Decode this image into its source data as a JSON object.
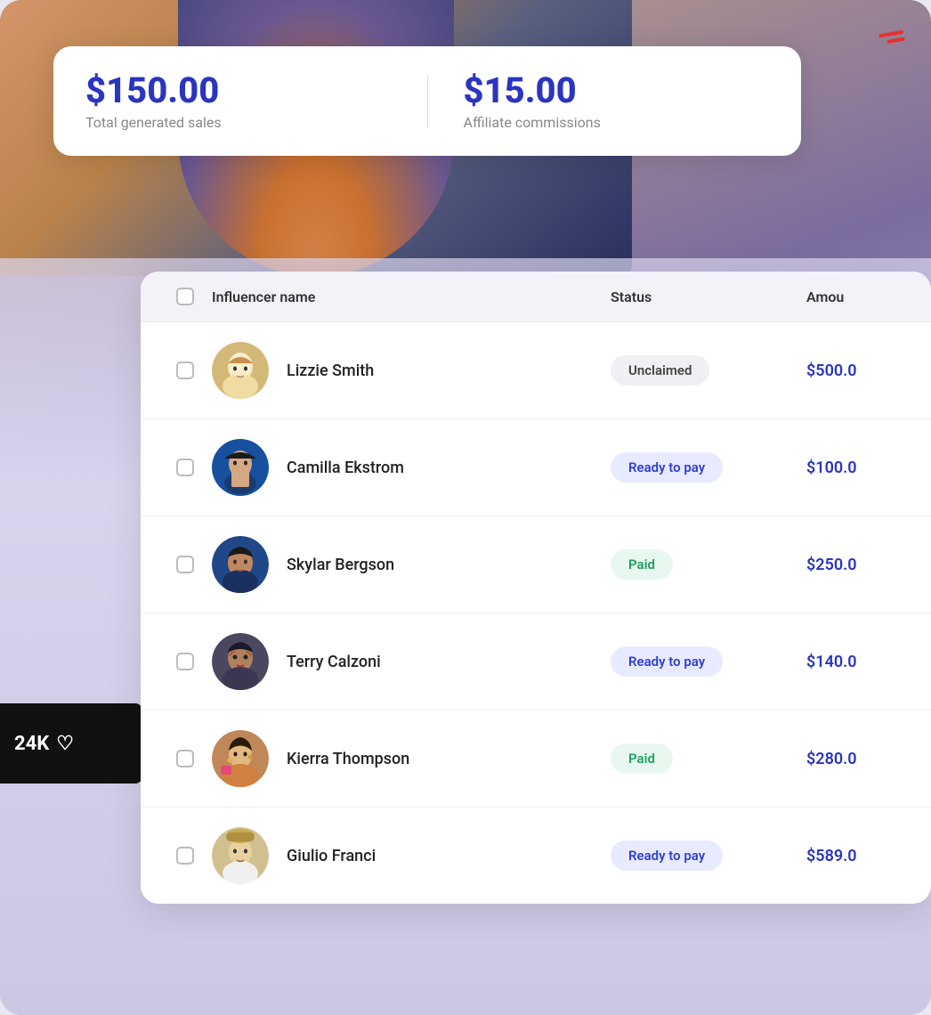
{
  "stats": {
    "total_sales_value": "$150.00",
    "total_sales_label": "Total generated sales",
    "commissions_value": "$15.00",
    "commissions_label": "Affiliate commissions"
  },
  "table": {
    "header": {
      "name_col": "Influencer name",
      "status_col": "Status",
      "amount_col": "Amou"
    },
    "rows": [
      {
        "name": "Lizzie Smith",
        "status": "Unclaimed",
        "status_type": "unclaimed",
        "amount": "$500.0"
      },
      {
        "name": "Camilla Ekstrom",
        "status": "Ready to pay",
        "status_type": "ready",
        "amount": "$100.0"
      },
      {
        "name": "Skylar Bergson",
        "status": "Paid",
        "status_type": "paid",
        "amount": "$250.0"
      },
      {
        "name": "Terry Calzoni",
        "status": "Ready to pay",
        "status_type": "ready",
        "amount": "$140.0"
      },
      {
        "name": "Kierra Thompson",
        "status": "Paid",
        "status_type": "paid",
        "amount": "$280.0"
      },
      {
        "name": "Giulio Franci",
        "status": "Ready to pay",
        "status_type": "ready",
        "amount": "$589.0"
      }
    ]
  },
  "social": {
    "likes": "24K"
  }
}
